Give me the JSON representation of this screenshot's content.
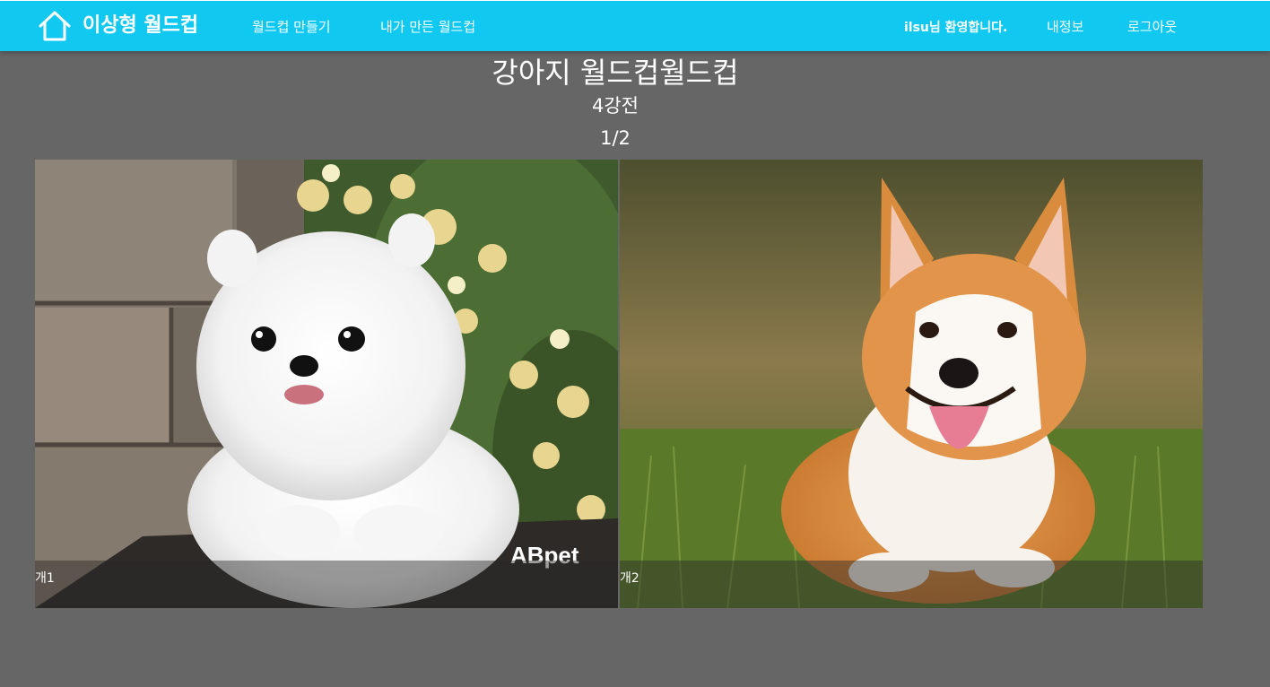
{
  "navbar": {
    "brand": "이상형 월드컵",
    "links": [
      "월드컵 만들기",
      "내가 만든 월드컵"
    ],
    "welcome": "ilsu님 환영합니다.",
    "my_info": "내정보",
    "logout": "로그아웃",
    "background_color": "#10c8f0"
  },
  "worldcup": {
    "title": "강아지 월드컵월드컵",
    "round": "4강전",
    "progress": "1/2"
  },
  "candidates": [
    {
      "name": "개1",
      "image_text": "ABpet",
      "subject": "white pomeranian puppy"
    },
    {
      "name": "개2",
      "subject": "smiling corgi"
    }
  ],
  "page_background": "#666666"
}
